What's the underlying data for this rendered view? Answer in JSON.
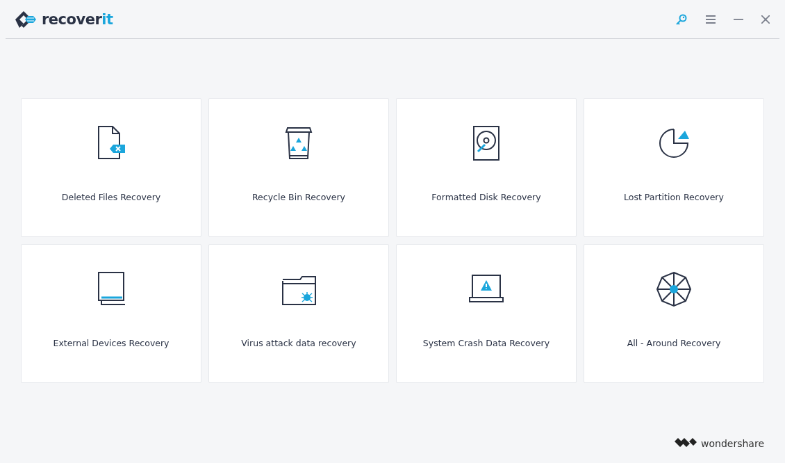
{
  "window": {
    "logo": {
      "text": "recover",
      "accent": "it"
    }
  },
  "cards": [
    {
      "kind": "deleted",
      "label": "Deleted Files Recovery"
    },
    {
      "kind": "recycle",
      "label": "Recycle Bin Recovery"
    },
    {
      "kind": "disk",
      "label": "Formatted Disk Recovery"
    },
    {
      "kind": "partition",
      "label": "Lost Partition Recovery"
    },
    {
      "kind": "external",
      "label": "External Devices Recovery"
    },
    {
      "kind": "virus",
      "label": "Virus attack data recovery"
    },
    {
      "kind": "crash",
      "label": "System Crash Data Recovery"
    },
    {
      "kind": "all",
      "label": "All - Around Recovery"
    }
  ],
  "footer": {
    "brand": "wondershare"
  }
}
